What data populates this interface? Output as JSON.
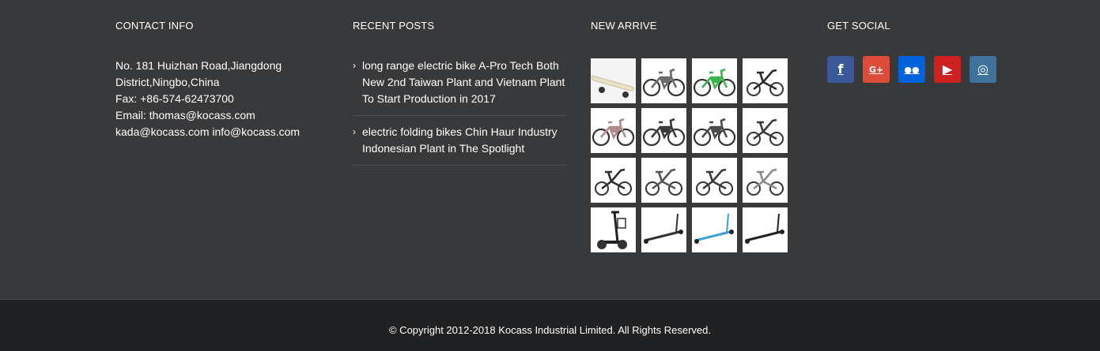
{
  "contact": {
    "title": "CONTACT INFO",
    "lines": [
      "No. 181 Huizhan Road,Jiangdong",
      "District,Ningbo,China",
      "Fax: +86-574-62473700",
      "Email: thomas@kocass.com",
      "kada@kocass.com info@kocass.com"
    ]
  },
  "posts": {
    "title": "RECENT POSTS",
    "items": [
      {
        "text": "long range electric bike A-Pro Tech Both New 2nd Taiwan Plant and Vietnam Plant To Start Production in 2017"
      },
      {
        "text": "electric folding bikes Chin Haur Industry Indonesian Plant in The Spotlight"
      }
    ]
  },
  "arrive": {
    "title": "NEW ARRIVE",
    "thumbs": [
      {
        "kind": "skateboard-icon",
        "accent": "#e8e2c8"
      },
      {
        "kind": "ebike-icon",
        "accent": "#6b6b6b"
      },
      {
        "kind": "ebike-icon",
        "accent": "#39b54a"
      },
      {
        "kind": "folding-bike-icon",
        "accent": "#2a2a2a"
      },
      {
        "kind": "bike-icon",
        "accent": "#b08a8a"
      },
      {
        "kind": "bike-icon",
        "accent": "#3a3a3a"
      },
      {
        "kind": "ebike-icon",
        "accent": "#4a4a4a"
      },
      {
        "kind": "folding-bike-icon",
        "accent": "#3a3a3a"
      },
      {
        "kind": "folding-bike-icon",
        "accent": "#2f2f2f"
      },
      {
        "kind": "folding-bike-icon",
        "accent": "#555555"
      },
      {
        "kind": "folding-bike-icon",
        "accent": "#3a3a3a"
      },
      {
        "kind": "folding-bike-icon",
        "accent": "#8a8a8a"
      },
      {
        "kind": "scooter-icon",
        "accent": "#222222"
      },
      {
        "kind": "kick-scooter-icon",
        "accent": "#333333"
      },
      {
        "kind": "kick-scooter-icon",
        "accent": "#3aa0d8"
      },
      {
        "kind": "kick-scooter-icon",
        "accent": "#222222"
      }
    ]
  },
  "social": {
    "title": "GET SOCIAL",
    "buttons": [
      {
        "name": "facebook-icon",
        "glyph": "f",
        "color": "#3b5998"
      },
      {
        "name": "google-plus-icon",
        "glyph": "G+",
        "color": "#dd4b39"
      },
      {
        "name": "flickr-icon",
        "glyph": "●●",
        "color": "#0063dc"
      },
      {
        "name": "youtube-icon",
        "glyph": "▶",
        "color": "#cd201f"
      },
      {
        "name": "instagram-icon",
        "glyph": "◎",
        "color": "#3f729b"
      }
    ]
  },
  "footer": {
    "copyright": "© Copyright 2012-2018 Kocass Industrial Limited. All Rights Reserved."
  }
}
